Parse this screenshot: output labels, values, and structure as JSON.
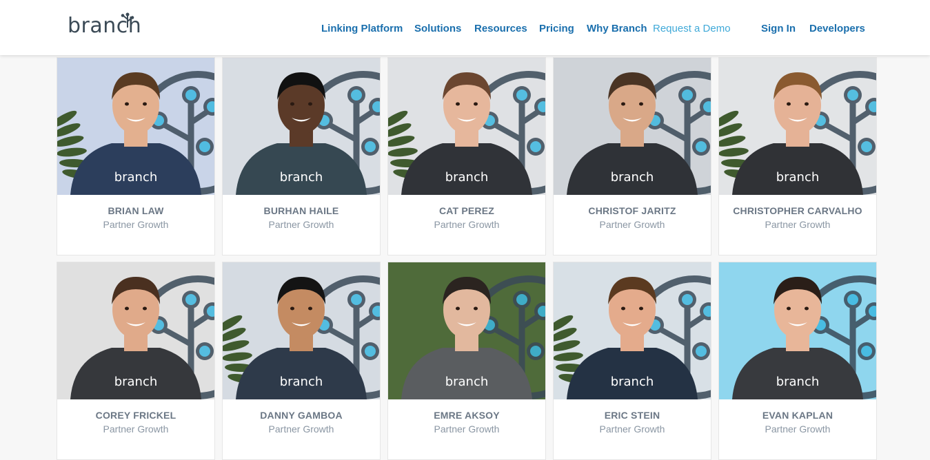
{
  "header": {
    "logo_text": "branch",
    "nav": {
      "linking_platform": "Linking Platform",
      "solutions": "Solutions",
      "resources": "Resources",
      "pricing": "Pricing",
      "why_branch": "Why Branch",
      "request_demo": "Request a Demo",
      "sign_in": "Sign In",
      "developers": "Developers"
    }
  },
  "team": [
    {
      "name": "BRIAN LAW",
      "role": "Partner Growth",
      "shirt_text": "branch",
      "bg": "#c9d4e8",
      "shirt": "#2c3e5c",
      "skin": "#e3b08f",
      "hair": "#5a3b22"
    },
    {
      "name": "BURHAN HAILE",
      "role": "Partner Growth",
      "shirt_text": "branch",
      "bg": "#d8dde3",
      "shirt": "#364852",
      "skin": "#5b3a28",
      "hair": "#111111"
    },
    {
      "name": "CAT PEREZ",
      "role": "Partner Growth",
      "shirt_text": "branch",
      "bg": "#dfe1e4",
      "shirt": "#303338",
      "skin": "#e6b79c",
      "hair": "#6b4630"
    },
    {
      "name": "CHRISTOF JARITZ",
      "role": "Partner Growth",
      "shirt_text": "branch",
      "bg": "#cfd3d8",
      "shirt": "#2f3237",
      "skin": "#d9a888",
      "hair": "#4a3424"
    },
    {
      "name": "CHRISTOPHER CARVALHO",
      "role": "Partner Growth",
      "shirt_text": "branch",
      "bg": "#e2e4e6",
      "shirt": "#303236",
      "skin": "#e5b296",
      "hair": "#8a5a30"
    },
    {
      "name": "COREY FRICKEL",
      "role": "Partner Growth",
      "shirt_text": "branch",
      "bg": "#e0e0e0",
      "shirt": "#36383c",
      "skin": "#e0aa8a",
      "hair": "#4a3020"
    },
    {
      "name": "DANNY GAMBOA",
      "role": "Partner Growth",
      "shirt_text": "branch",
      "bg": "#d5dbe2",
      "shirt": "#2e3a4a",
      "skin": "#c48b62",
      "hair": "#141414"
    },
    {
      "name": "EMRE AKSOY",
      "role": "Partner Growth",
      "shirt_text": "branch",
      "bg": "#4f6b3a",
      "shirt": "#5a5d60",
      "skin": "#e2b89e",
      "hair": "#2b2420"
    },
    {
      "name": "ERIC STEIN",
      "role": "Partner Growth",
      "shirt_text": "branch",
      "bg": "#d8e0e6",
      "shirt": "#243244",
      "skin": "#e4ab8c",
      "hair": "#5b3a20"
    },
    {
      "name": "EVAN KAPLAN",
      "role": "Partner Growth",
      "shirt_text": "branch",
      "bg": "#8fd6ee",
      "shirt": "#383a3e",
      "skin": "#e8b699",
      "hair": "#2a1e18"
    }
  ],
  "colors": {
    "nav_link": "#1a6fad",
    "demo_link": "#3fa9d8",
    "branch_tree": "#3a4a58",
    "tree_node": "#3db8e0"
  }
}
